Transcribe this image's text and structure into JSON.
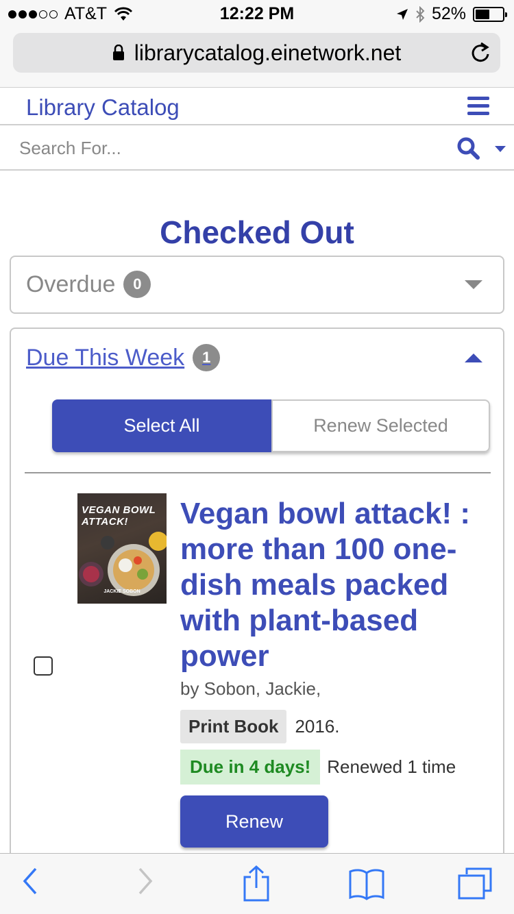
{
  "status_bar": {
    "carrier": "AT&T",
    "time": "12:22 PM",
    "battery": "52%",
    "battery_level": 0.52
  },
  "browser": {
    "url": "librarycatalog.einetwork.net"
  },
  "site": {
    "brand": "Library Catalog",
    "search_placeholder": "Search For..."
  },
  "page": {
    "title": "Checked Out"
  },
  "overdue": {
    "label": "Overdue",
    "count": "0"
  },
  "due_this_week": {
    "label": "Due This Week",
    "count": "1",
    "select_all_label": "Select All",
    "renew_selected_label": "Renew Selected"
  },
  "item": {
    "cover_title": "VEGAN BOWL ATTACK!",
    "cover_author": "JACKIE SOBON",
    "title": "Vegan bowl attack! : more than 100 one-dish meals packed with plant-based power",
    "author": "by Sobon, Jackie,",
    "format": "Print Book",
    "year": "2016.",
    "due": "Due in 4 days!",
    "renewed": "Renewed 1 time",
    "renew_label": "Renew"
  },
  "colors": {
    "brand": "#3d4db7",
    "due_bg": "#d5f0d5",
    "due_text": "#1e8a22",
    "badge": "#8c8c8c"
  },
  "icons": [
    "lock-icon",
    "reload-icon",
    "hamburger-icon",
    "search-icon",
    "chevron-down-icon",
    "chevron-up-icon",
    "back-icon",
    "forward-icon",
    "share-icon",
    "bookmarks-icon",
    "tabs-icon"
  ]
}
